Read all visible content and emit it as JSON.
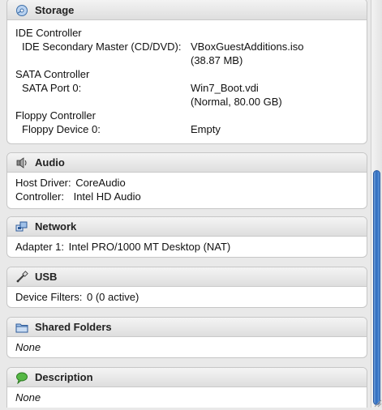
{
  "storage": {
    "title": "Storage",
    "icon": "storage-icon",
    "controllers": [
      {
        "name": "IDE Controller",
        "device": "IDE Secondary Master (CD/DVD):",
        "value_line1": "VBoxGuestAdditions.iso",
        "value_line2": "(38.87 MB)"
      },
      {
        "name": "SATA Controller",
        "device": "SATA Port 0:",
        "value_line1": "Win7_Boot.vdi",
        "value_line2": "(Normal, 80.00 GB)"
      },
      {
        "name": "Floppy Controller",
        "device": "Floppy Device 0:",
        "value_line1": "Empty"
      }
    ]
  },
  "audio": {
    "title": "Audio",
    "icon": "audio-icon",
    "host_driver_label": "Host Driver:",
    "host_driver_value": "CoreAudio",
    "controller_label": "Controller:",
    "controller_value": "Intel HD Audio"
  },
  "network": {
    "title": "Network",
    "icon": "network-icon",
    "adapter_label": "Adapter 1:",
    "adapter_value": "Intel PRO/1000 MT Desktop (NAT)"
  },
  "usb": {
    "title": "USB",
    "icon": "usb-icon",
    "filters_label": "Device Filters:",
    "filters_value": "0 (0 active)"
  },
  "shared_folders": {
    "title": "Shared Folders",
    "icon": "folder-icon",
    "value": "None"
  },
  "description": {
    "title": "Description",
    "icon": "speech-bubble-icon",
    "value": "None"
  },
  "colors": {
    "scroll_thumb": "#2f6cc0",
    "header_top": "#f4f4f4",
    "header_bottom": "#dedede"
  }
}
